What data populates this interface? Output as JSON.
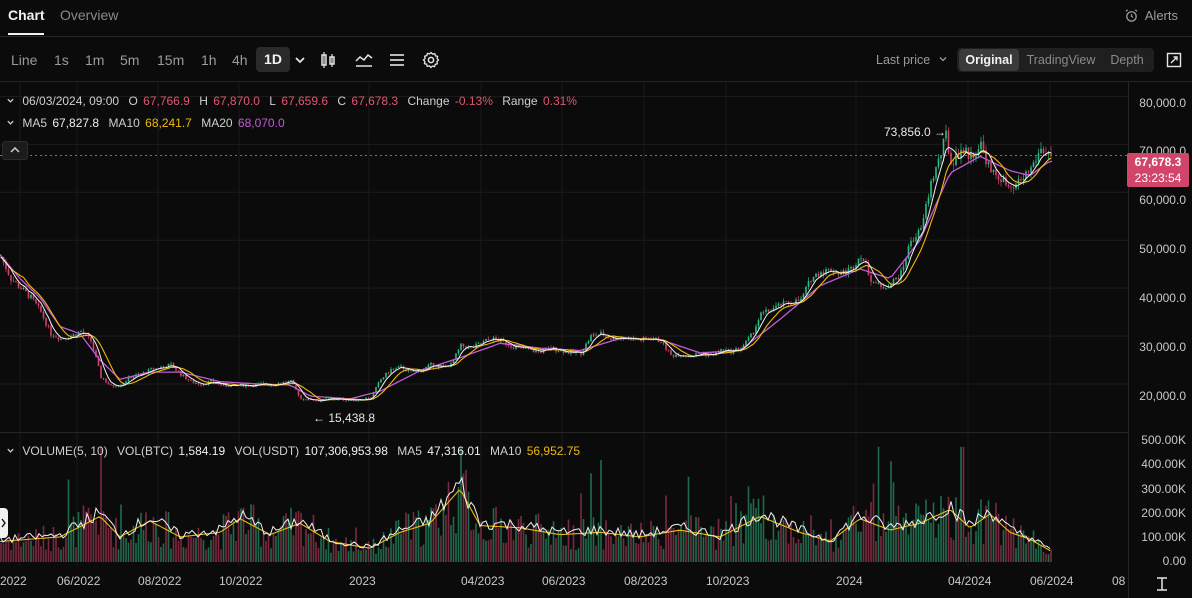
{
  "tabs": {
    "chart": "Chart",
    "overview": "Overview"
  },
  "alerts_label": "Alerts",
  "timeframes": [
    "Line",
    "1s",
    "1m",
    "5m",
    "15m",
    "1h",
    "4h"
  ],
  "active_timeframe": "1D",
  "price_mode": "Last price",
  "views": {
    "original": "Original",
    "tradingview": "TradingView",
    "depth": "Depth"
  },
  "ohlc": {
    "date": "06/03/2024, 09:00",
    "o_label": "O",
    "o": "67,766.9",
    "h_label": "H",
    "h": "67,870.0",
    "l_label": "L",
    "l": "67,659.6",
    "c_label": "C",
    "c": "67,678.3",
    "change_label": "Change",
    "change": "-0.13%",
    "range_label": "Range",
    "range": "0.31%"
  },
  "ma": {
    "ma5_label": "MA5",
    "ma5": "67,827.8",
    "ma10_label": "MA10",
    "ma10": "68,241.7",
    "ma20_label": "MA20",
    "ma20": "68,070.0"
  },
  "volume": {
    "title": "VOLUME(5, 10)",
    "btc_label": "VOL(BTC)",
    "btc": "1,584.19",
    "usdt_label": "VOL(USDT)",
    "usdt": "107,306,953.98",
    "ma5_label": "MA5",
    "ma5": "47,316.01",
    "ma10_label": "MA10",
    "ma10": "56,952.75"
  },
  "price_axis": [
    "80,000.0",
    "70,000.0",
    "60,000.0",
    "50,000.0",
    "40,000.0",
    "30,000.0",
    "20,000.0"
  ],
  "volume_axis": [
    "500.00K",
    "400.00K",
    "300.00K",
    "200.00K",
    "100.00K",
    "0.00"
  ],
  "x_axis": [
    "2022",
    "06/2022",
    "08/2022",
    "10/2022",
    "2023",
    "04/2023",
    "06/2023",
    "08/2023",
    "10/2023",
    "2024",
    "04/2024",
    "06/2024",
    "08"
  ],
  "current_price": {
    "value": "67,678.3",
    "countdown": "23:23:54"
  },
  "annotations": {
    "high": "73,856.0",
    "low": "15,438.8"
  },
  "colors": {
    "up": "#2ebd85",
    "down": "#d2456a",
    "ma5": "#f0f0f0",
    "ma10": "#f0b90b",
    "ma20": "#c45ad8"
  },
  "chart_data": {
    "type": "candlestick",
    "price_ylim": [
      10000,
      83000
    ],
    "volume_ylim": [
      0,
      500000
    ],
    "close_series": [
      [
        0,
        46500
      ],
      [
        10,
        42000
      ],
      [
        20,
        40000
      ],
      [
        30,
        38000
      ],
      [
        40,
        35000
      ],
      [
        50,
        30500
      ],
      [
        60,
        29500
      ],
      [
        70,
        30000
      ],
      [
        80,
        31000
      ],
      [
        90,
        29000
      ],
      [
        100,
        21500
      ],
      [
        110,
        19500
      ],
      [
        120,
        20000
      ],
      [
        130,
        21500
      ],
      [
        140,
        22000
      ],
      [
        150,
        23000
      ],
      [
        160,
        23500
      ],
      [
        170,
        24000
      ],
      [
        180,
        22000
      ],
      [
        190,
        20500
      ],
      [
        200,
        20000
      ],
      [
        210,
        20500
      ],
      [
        220,
        19800
      ],
      [
        230,
        19600
      ],
      [
        240,
        19800
      ],
      [
        250,
        19700
      ],
      [
        260,
        20000
      ],
      [
        270,
        19800
      ],
      [
        280,
        20300
      ],
      [
        290,
        20500
      ],
      [
        300,
        17000
      ],
      [
        310,
        16800
      ],
      [
        320,
        16500
      ],
      [
        330,
        17000
      ],
      [
        340,
        16800
      ],
      [
        350,
        16700
      ],
      [
        360,
        16800
      ],
      [
        370,
        17200
      ],
      [
        380,
        21000
      ],
      [
        390,
        23000
      ],
      [
        400,
        23500
      ],
      [
        410,
        22500
      ],
      [
        420,
        22800
      ],
      [
        430,
        24000
      ],
      [
        440,
        23500
      ],
      [
        450,
        24000
      ],
      [
        460,
        28000
      ],
      [
        470,
        27500
      ],
      [
        480,
        28500
      ],
      [
        490,
        29500
      ],
      [
        500,
        29000
      ],
      [
        510,
        28000
      ],
      [
        520,
        27500
      ],
      [
        530,
        27000
      ],
      [
        540,
        26800
      ],
      [
        550,
        27500
      ],
      [
        560,
        27000
      ],
      [
        570,
        26500
      ],
      [
        580,
        26500
      ],
      [
        590,
        30000
      ],
      [
        600,
        30500
      ],
      [
        610,
        29500
      ],
      [
        620,
        29800
      ],
      [
        630,
        29500
      ],
      [
        640,
        29200
      ],
      [
        650,
        29500
      ],
      [
        660,
        29000
      ],
      [
        670,
        26000
      ],
      [
        680,
        26200
      ],
      [
        690,
        25800
      ],
      [
        700,
        26500
      ],
      [
        710,
        26000
      ],
      [
        720,
        27000
      ],
      [
        730,
        26800
      ],
      [
        740,
        27500
      ],
      [
        750,
        30000
      ],
      [
        760,
        34500
      ],
      [
        770,
        35500
      ],
      [
        780,
        36500
      ],
      [
        790,
        37000
      ],
      [
        800,
        37500
      ],
      [
        810,
        42000
      ],
      [
        820,
        43500
      ],
      [
        830,
        43800
      ],
      [
        840,
        43000
      ],
      [
        850,
        44000
      ],
      [
        860,
        47000
      ],
      [
        870,
        42000
      ],
      [
        880,
        40000
      ],
      [
        890,
        41000
      ],
      [
        900,
        43000
      ],
      [
        910,
        50000
      ],
      [
        920,
        52000
      ],
      [
        930,
        62000
      ],
      [
        940,
        68000
      ],
      [
        945,
        72000
      ],
      [
        950,
        66000
      ],
      [
        960,
        69000
      ],
      [
        970,
        67500
      ],
      [
        980,
        70000
      ],
      [
        990,
        64000
      ],
      [
        1000,
        63000
      ],
      [
        1010,
        60000
      ],
      [
        1020,
        62500
      ],
      [
        1030,
        65000
      ],
      [
        1040,
        69000
      ],
      [
        1050,
        67678
      ]
    ],
    "ma20_series": [
      [
        0,
        47000
      ],
      [
        20,
        42000
      ],
      [
        40,
        38000
      ],
      [
        60,
        32000
      ],
      [
        80,
        30500
      ],
      [
        100,
        25000
      ],
      [
        120,
        21000
      ],
      [
        150,
        22500
      ],
      [
        180,
        22500
      ],
      [
        220,
        20500
      ],
      [
        260,
        20000
      ],
      [
        290,
        19800
      ],
      [
        310,
        17500
      ],
      [
        350,
        16900
      ],
      [
        380,
        18500
      ],
      [
        420,
        22800
      ],
      [
        460,
        25500
      ],
      [
        500,
        28500
      ],
      [
        540,
        27500
      ],
      [
        580,
        27000
      ],
      [
        620,
        29500
      ],
      [
        660,
        29300
      ],
      [
        700,
        26500
      ],
      [
        740,
        27000
      ],
      [
        780,
        33500
      ],
      [
        820,
        40500
      ],
      [
        860,
        44000
      ],
      [
        890,
        42000
      ],
      [
        920,
        50000
      ],
      [
        950,
        64000
      ],
      [
        980,
        67500
      ],
      [
        1010,
        64500
      ],
      [
        1030,
        63500
      ],
      [
        1050,
        66500
      ]
    ],
    "volume_ma": [
      [
        0,
        90000
      ],
      [
        30,
        100000
      ],
      [
        60,
        110000
      ],
      [
        100,
        200000
      ],
      [
        120,
        110000
      ],
      [
        150,
        180000
      ],
      [
        180,
        110000
      ],
      [
        220,
        130000
      ],
      [
        240,
        190000
      ],
      [
        270,
        120000
      ],
      [
        300,
        170000
      ],
      [
        330,
        90000
      ],
      [
        370,
        60000
      ],
      [
        400,
        130000
      ],
      [
        430,
        170000
      ],
      [
        460,
        320000
      ],
      [
        480,
        160000
      ],
      [
        520,
        150000
      ],
      [
        560,
        120000
      ],
      [
        600,
        130000
      ],
      [
        640,
        110000
      ],
      [
        680,
        140000
      ],
      [
        720,
        110000
      ],
      [
        760,
        200000
      ],
      [
        800,
        130000
      ],
      [
        830,
        90000
      ],
      [
        860,
        190000
      ],
      [
        890,
        140000
      ],
      [
        920,
        170000
      ],
      [
        950,
        230000
      ],
      [
        970,
        150000
      ],
      [
        990,
        210000
      ],
      [
        1010,
        130000
      ],
      [
        1030,
        100000
      ],
      [
        1050,
        50000
      ]
    ]
  }
}
